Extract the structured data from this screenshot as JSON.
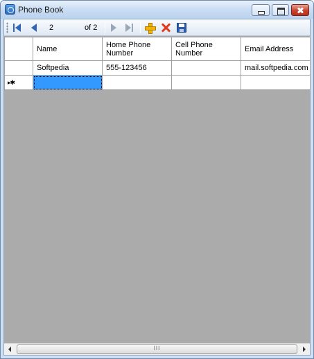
{
  "window": {
    "title": "Phone Book"
  },
  "toolbar": {
    "position_value": "2",
    "position_of": "of 2"
  },
  "grid": {
    "columns": [
      "Name",
      "Home Phone Number",
      "Cell Phone Number",
      "Email Address"
    ],
    "rows": [
      {
        "name": "Softpedia",
        "home_phone": "555-123456",
        "cell_phone": "",
        "email": "mail.softpedia.com"
      }
    ],
    "new_row_glyph": "▸✱"
  },
  "colors": {
    "selection": "#3399ff",
    "empty_area": "#ababab"
  }
}
